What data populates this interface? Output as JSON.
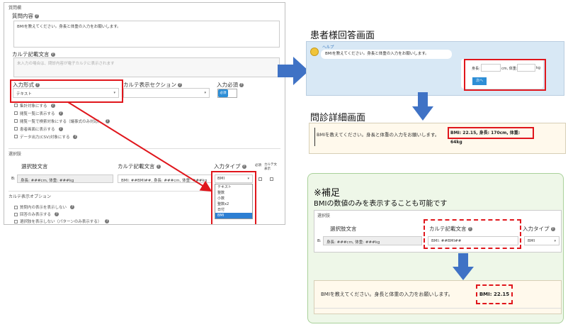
{
  "editor": {
    "section_question": "質問欄",
    "question_label": "質問内容",
    "question_value": "BMIを教えてください。身長と体重の入力をお願いします。",
    "karte_label": "カルテ記載文言",
    "karte_placeholder": "未入力の場合は、問診内容が電子カルテに表示されます",
    "input_format_label": "入力形式",
    "input_format_value": "テキスト",
    "karte_section_label": "カルテ表示セクション",
    "required_label": "入力必須",
    "required_toggle": "必須",
    "options": [
      "集計対象にする",
      "閲覧一覧に表示する",
      "閲覧一覧で検索対象にする（議事式のみ対応）",
      "患者画面に表示する",
      "データ出力(CSV)対象にする"
    ],
    "section_choices": "選択肢",
    "col_choice_text": "選択肢文言",
    "col_karte_text": "カルテ記載文言",
    "col_input_type": "入力タイプ",
    "col_required": "必須",
    "col_karte_display": "カルテ文表示",
    "row_prefix": "B:",
    "row_choice_value": "身長: ###cm, 体重: ###kg",
    "row_karte_value": "BMI: ##BMI##, 身長: ###cm, 体重: ###kg",
    "input_type_value": "BMI",
    "dropdown_items": [
      "テキスト",
      "整数",
      "小数",
      "整数x2",
      "日付",
      "BMI"
    ],
    "dropdown_selected": "BMI",
    "section_display": "カルテ表示オプション",
    "display_options": [
      "質問内の表示を表示しない",
      "回答のみ表示する",
      "選択肢を表示しない（パターンのみ表示する）"
    ]
  },
  "patient": {
    "heading": "患者様回答画面",
    "help_label": "ヘルプ",
    "bubble_text": "BMIを教えてください。身長と体重の入力をお願いします。",
    "height_label": "身長:",
    "height_unit": "cm, 体重:",
    "weight_unit": "kg",
    "next_button": "次へ"
  },
  "detail": {
    "heading": "問診詳細画面",
    "text": "BMIを教えてください。身長と体重の入力をお願いします。",
    "highlight": "BMI: 22.15, 身長: 170cm, 体重: 64kg"
  },
  "supplement": {
    "heading": "※補足",
    "subheading": "BMIの数値のみを表示することも可能です",
    "section_choices": "選択肢",
    "col_choice_text": "選択肢文言",
    "col_karte_text": "カルテ記載文言",
    "col_input_type": "入力タイプ",
    "row_prefix": "B:",
    "row_choice_value": "身長: ###cm, 体重: ###kg",
    "row_karte_value": "BMI: ##BMI##",
    "input_type_value": "BMI",
    "result_text": "BMIを教えてください。身長と体重の入力をお願いします。",
    "result_highlight": "BMI: 22.15"
  },
  "colors": {
    "red": "#e0161c",
    "blue_arrow": "#3f72c5",
    "accent": "#2d8ed6"
  }
}
